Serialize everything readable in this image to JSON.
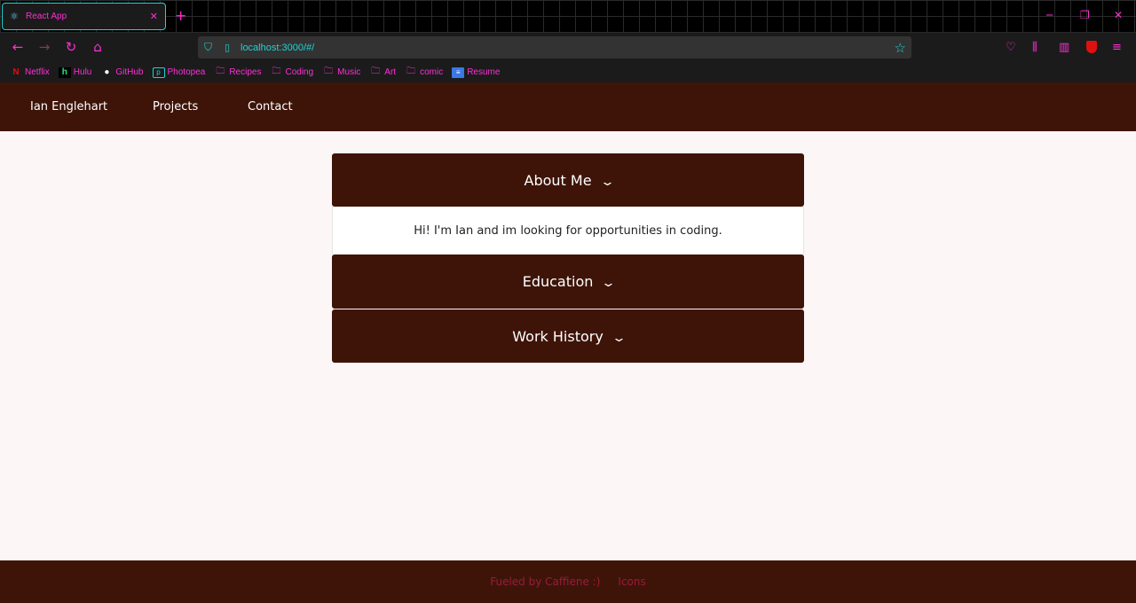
{
  "browser": {
    "tab_title": "React App",
    "url": "localhost:3000/#/",
    "bookmarks": [
      {
        "label": "Netflix",
        "icon": "netflix-icon"
      },
      {
        "label": "Hulu",
        "icon": "hulu-icon"
      },
      {
        "label": "GitHub",
        "icon": "github-icon"
      },
      {
        "label": "Photopea",
        "icon": "photopea-icon"
      },
      {
        "label": "Recipes",
        "icon": "folder-icon"
      },
      {
        "label": "Coding",
        "icon": "folder-icon"
      },
      {
        "label": "Music",
        "icon": "folder-icon"
      },
      {
        "label": "Art",
        "icon": "folder-icon"
      },
      {
        "label": "comic",
        "icon": "folder-icon"
      },
      {
        "label": "Resume",
        "icon": "doc-icon"
      }
    ]
  },
  "site_nav": {
    "brand": "Ian Englehart",
    "projects": "Projects",
    "contact": "Contact"
  },
  "accordion": {
    "about": {
      "title": "About Me",
      "body": "Hi! I'm Ian and im looking for opportunities in coding."
    },
    "education": {
      "title": "Education"
    },
    "work": {
      "title": "Work History"
    }
  },
  "footer": {
    "credit": "Fueled by Caffiene :)",
    "icons": "Icons"
  },
  "colors": {
    "brand_dark": "#3e1409",
    "browser_accent_pink": "#ff2fd6",
    "browser_accent_cyan": "#1fd3d3",
    "footer_text": "#9a1b3a"
  }
}
